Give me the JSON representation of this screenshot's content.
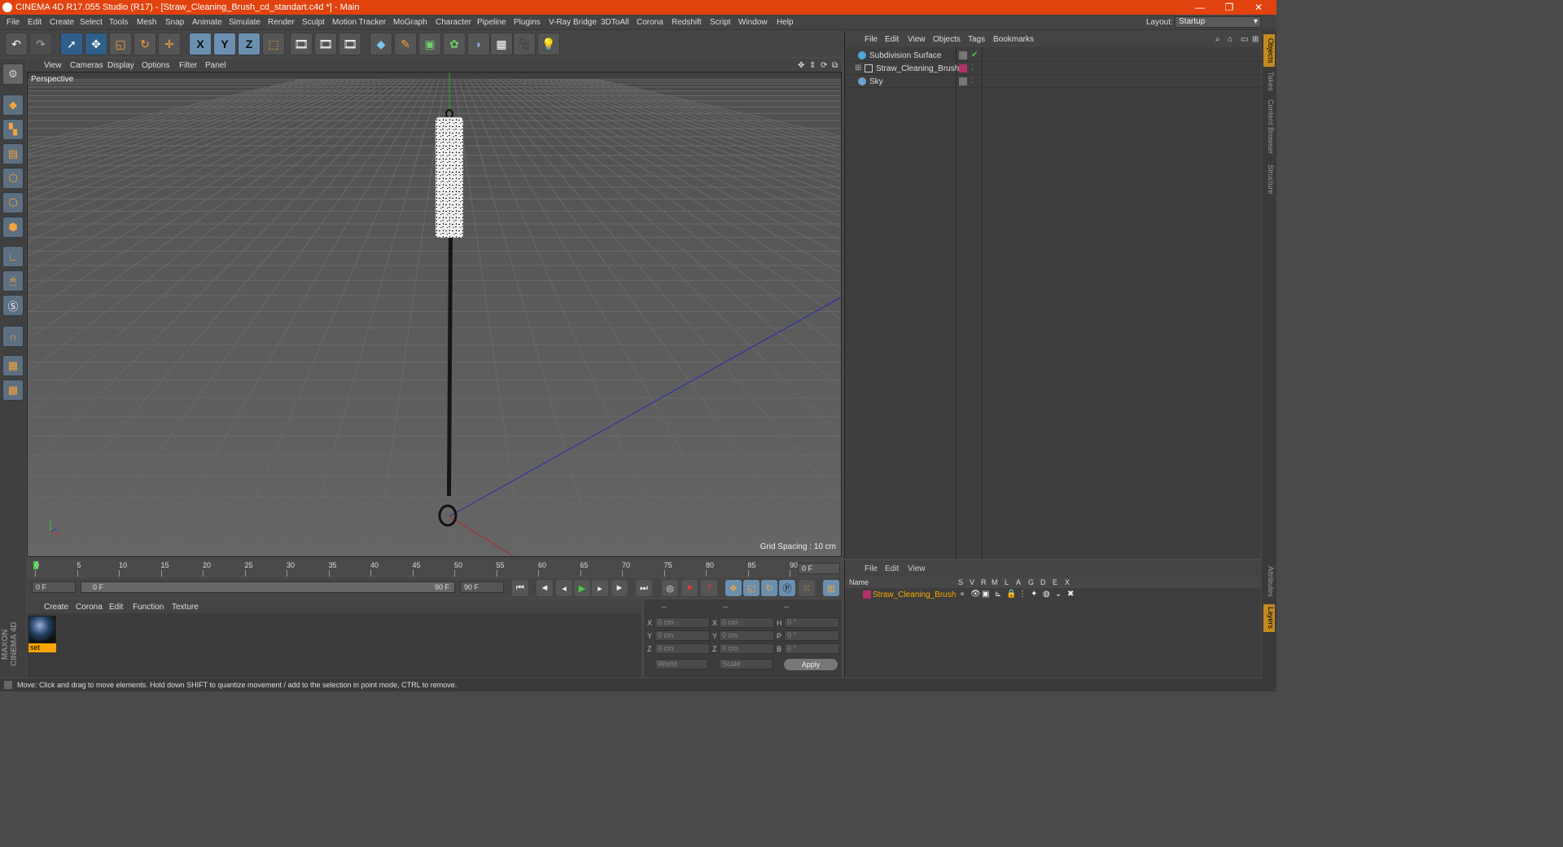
{
  "titlebar": {
    "title": "CINEMA 4D R17.055 Studio (R17) - [Straw_Cleaning_Brush_cd_standart.c4d *] - Main",
    "minimize": "—",
    "restore": "❐",
    "close": "✕"
  },
  "menubar": {
    "items": [
      "File",
      "Edit",
      "Create",
      "Select",
      "Tools",
      "Mesh",
      "Snap",
      "Animate",
      "Simulate",
      "Render",
      "Sculpt",
      "Motion Tracker",
      "MoGraph",
      "Character",
      "Pipeline",
      "Plugins",
      "V-Ray Bridge",
      "3DToAll",
      "Corona",
      "Redshift",
      "Script",
      "Window",
      "Help"
    ],
    "layout_label": "Layout:",
    "layout_value": "Startup"
  },
  "toolbar": {
    "axis_x": "X",
    "axis_y": "Y",
    "axis_z": "Z"
  },
  "viewport": {
    "menu": [
      "View",
      "Cameras",
      "Display",
      "Options",
      "Filter",
      "Panel"
    ],
    "label": "Perspective",
    "grid_spacing": "Grid Spacing : 10 cm"
  },
  "timeline": {
    "ticks": [
      "0",
      "5",
      "10",
      "15",
      "20",
      "25",
      "30",
      "35",
      "40",
      "45",
      "50",
      "55",
      "60",
      "65",
      "70",
      "75",
      "80",
      "85",
      "90"
    ],
    "current_frame_field": "0 F"
  },
  "playbar": {
    "start": "0 F",
    "range_start": "0 F",
    "range_end": "90 F",
    "end": "90 F"
  },
  "materials": {
    "menu": [
      "Create",
      "Corona",
      "Edit",
      "Function",
      "Texture"
    ],
    "items": [
      {
        "name": "set"
      }
    ]
  },
  "coords": {
    "headers": [
      "--",
      "--",
      "--"
    ],
    "rows": [
      {
        "l1": "X",
        "v1": "0 cm",
        "l2": "X",
        "v2": "0 cm",
        "l3": "H",
        "v3": "0 °"
      },
      {
        "l1": "Y",
        "v1": "0 cm",
        "l2": "Y",
        "v2": "0 cm",
        "l3": "P",
        "v3": "0 °"
      },
      {
        "l1": "Z",
        "v1": "0 cm",
        "l2": "Z",
        "v2": "0 cm",
        "l3": "B",
        "v3": "0 °"
      }
    ],
    "space": "World",
    "mode": "Scale",
    "apply": "Apply"
  },
  "objects": {
    "menu": [
      "File",
      "Edit",
      "View",
      "Objects",
      "Tags",
      "Bookmarks"
    ],
    "rows": [
      {
        "name": "Subdivision Surface",
        "color": "#4fa8d8"
      },
      {
        "name": "Straw_Cleaning_Brush",
        "color": "#c0c0c0"
      },
      {
        "name": "Sky",
        "color": "#6fa0d0"
      }
    ]
  },
  "layers": {
    "menu": [
      "File",
      "Edit",
      "View"
    ],
    "columns": [
      "Name",
      "S",
      "V",
      "R",
      "M",
      "L",
      "A",
      "G",
      "D",
      "E",
      "X"
    ],
    "rows": [
      {
        "name": "Straw_Cleaning_Brush",
        "color": "#b0306a"
      }
    ]
  },
  "rightstrip": {
    "tabs": [
      "Objects",
      "Takes",
      "Content Browser",
      "Structure",
      "Attributes",
      "Layers"
    ]
  },
  "status": {
    "text": "Move: Click and drag to move elements. Hold down SHIFT to quantize movement / add to the selection in point mode, CTRL to remove."
  },
  "maxon": "MAXON CINEMA 4D",
  "colors": {
    "title_accent": "#e2420d",
    "active_tool": "#2f5f8c",
    "material_label": "#f7a500",
    "layer_text": "#f7a500"
  }
}
